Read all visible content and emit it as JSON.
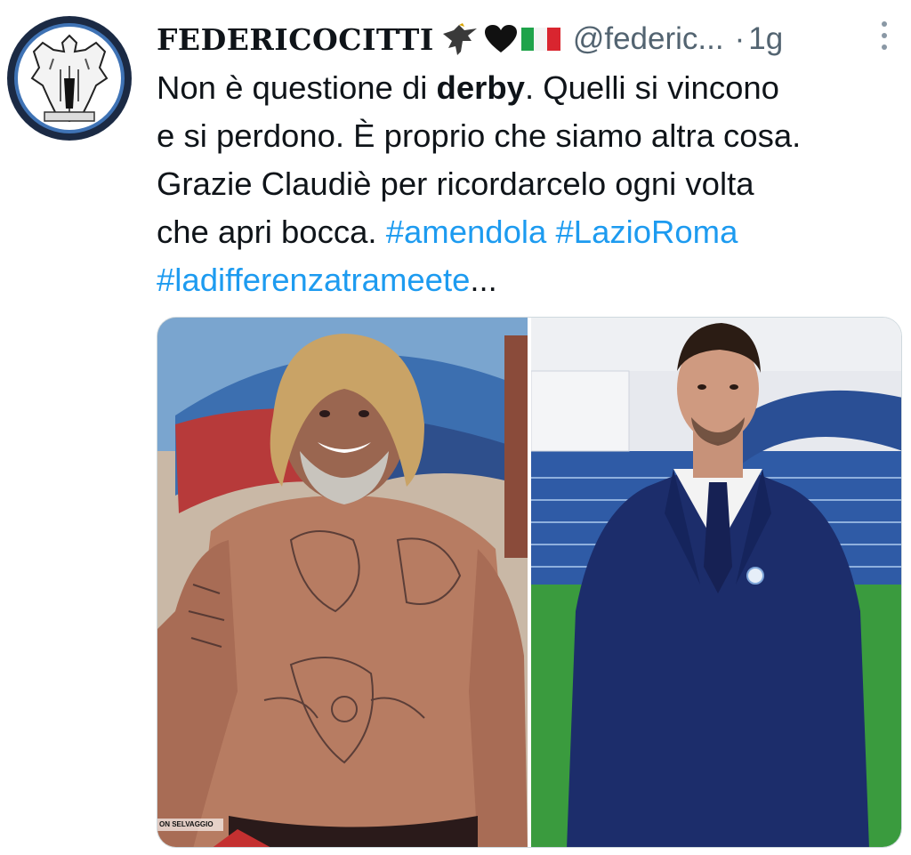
{
  "tweet": {
    "display_name": "FEDERICOCITTI",
    "flair_icons": [
      "eagle-icon",
      "black-heart-icon",
      "italy-flag-icon"
    ],
    "handle": "@federic...",
    "separator": "·",
    "time": "1g",
    "more_icon": "more-vertical-icon",
    "text": {
      "line1_a": "Non è questione di ",
      "line1_bold": "derby",
      "line1_b": ". Quelli si vincono",
      "line2": "e si perdono. È proprio che siamo altra cosa.",
      "line3": "Grazie Claudiè per ricordarcelo ogni volta",
      "line4_a": "che apri bocca. ",
      "hashtag1": "#amendola",
      "hashtag2": "#LazioRoma",
      "hashtag3": "#ladifferenzatrameete",
      "ellipsis": "..."
    },
    "media": {
      "left_photo": "shirtless-tattooed-man-beach-photo",
      "right_photo": "man-in-blue-suit-stadium-photo",
      "caption": "ON SELVAGGIO"
    }
  },
  "colors": {
    "link": "#1d9bf0",
    "text": "#0f1419",
    "secondary": "#536471"
  }
}
